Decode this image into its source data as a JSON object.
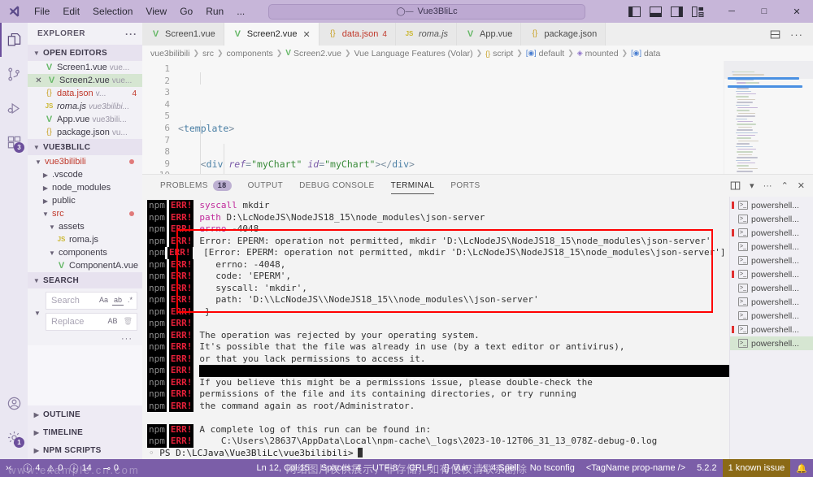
{
  "titlebar": {
    "menu": [
      "File",
      "Edit",
      "Selection",
      "View",
      "Go",
      "Run",
      "..."
    ],
    "search_value": "Vue3BliLc",
    "search_icon": "search-icon",
    "nav_back": "←",
    "nav_forward": "→",
    "minimize": "─",
    "maximize": "□",
    "close": "✕"
  },
  "activitybar": {
    "items": [
      {
        "name": "explorer",
        "icon": "files-icon",
        "badge": ""
      },
      {
        "name": "source-control",
        "icon": "source-control-icon",
        "badge": ""
      },
      {
        "name": "run-debug",
        "icon": "run-debug-icon",
        "badge": ""
      },
      {
        "name": "extensions",
        "icon": "extensions-icon",
        "badge": "3"
      }
    ],
    "account_badge": "",
    "settings_badge": "1"
  },
  "sidebar": {
    "title": "EXPLORER",
    "more": "···",
    "open_editors": {
      "label": "OPEN EDITORS",
      "items": [
        {
          "icon": "vue",
          "name": "Screen1.vue",
          "path": "vue...",
          "badge": "",
          "selected": false,
          "close": false
        },
        {
          "icon": "vue",
          "name": "Screen2.vue",
          "path": "vue...",
          "badge": "",
          "selected": true,
          "close": true
        },
        {
          "icon": "json",
          "name": "data.json",
          "path": "v...",
          "badge": "4",
          "selected": false,
          "close": false
        },
        {
          "icon": "js",
          "name": "roma.js",
          "path": "vue3bilibi...",
          "badge": "",
          "selected": false,
          "close": false
        },
        {
          "icon": "vue",
          "name": "App.vue",
          "path": "vue3bili...",
          "badge": "",
          "selected": false,
          "close": false
        },
        {
          "icon": "json",
          "name": "package.json",
          "path": "vu...",
          "badge": "",
          "selected": false,
          "close": false
        }
      ]
    },
    "project": {
      "label": "VUE3BLILC",
      "items": [
        {
          "name": "vue3bilibili",
          "depth": 1,
          "expanded": true,
          "red": true,
          "dot": true,
          "icon": ""
        },
        {
          "name": ".vscode",
          "depth": 2,
          "expanded": false,
          "red": false,
          "dot": false,
          "icon": ""
        },
        {
          "name": "node_modules",
          "depth": 2,
          "expanded": false,
          "red": false,
          "dot": false,
          "icon": ""
        },
        {
          "name": "public",
          "depth": 2,
          "expanded": false,
          "red": false,
          "dot": false,
          "icon": ""
        },
        {
          "name": "src",
          "depth": 2,
          "expanded": true,
          "red": true,
          "dot": true,
          "icon": ""
        },
        {
          "name": "assets",
          "depth": 3,
          "expanded": true,
          "red": false,
          "dot": false,
          "icon": ""
        },
        {
          "name": "roma.js",
          "depth": 4,
          "expanded": null,
          "red": false,
          "dot": false,
          "icon": "js"
        },
        {
          "name": "components",
          "depth": 3,
          "expanded": true,
          "red": false,
          "dot": false,
          "icon": ""
        },
        {
          "name": "ComponentA.vue",
          "depth": 4,
          "expanded": null,
          "red": false,
          "dot": false,
          "icon": "vue"
        }
      ]
    },
    "search": {
      "label": "SEARCH",
      "search_placeholder": "Search",
      "search_value": "",
      "replace_placeholder": "Replace",
      "replace_value": "",
      "match_case": "Aa",
      "whole_word": "ab",
      "regex": ".*",
      "preserve_case": "AB",
      "replace_all_icon": "replace-all-icon",
      "more": "···"
    },
    "bottom_sections": [
      "OUTLINE",
      "TIMELINE",
      "NPM SCRIPTS"
    ]
  },
  "editor": {
    "tabs": [
      {
        "icon": "vue",
        "label": "Screen1.vue",
        "active": false,
        "close": false,
        "badge": "",
        "italic": false
      },
      {
        "icon": "vue",
        "label": "Screen2.vue",
        "active": true,
        "close": true,
        "badge": "",
        "italic": false
      },
      {
        "icon": "json",
        "label": "data.json",
        "active": false,
        "close": false,
        "badge": "4",
        "italic": false,
        "red": true
      },
      {
        "icon": "js",
        "label": "roma.js",
        "active": false,
        "close": false,
        "badge": "",
        "italic": true
      },
      {
        "icon": "vue",
        "label": "App.vue",
        "active": false,
        "close": false,
        "badge": "",
        "italic": false
      },
      {
        "icon": "json",
        "label": "package.json",
        "active": false,
        "close": false,
        "badge": "",
        "italic": false
      }
    ],
    "tabs_right": {
      "split_icon": "split-editor-icon",
      "more": "···"
    },
    "breadcrumb": [
      {
        "label": "vue3bilibili",
        "icon": ""
      },
      {
        "label": "src",
        "icon": ""
      },
      {
        "label": "components",
        "icon": ""
      },
      {
        "label": "Screen2.vue",
        "icon": "vue"
      },
      {
        "label": "Vue Language Features (Volar)",
        "icon": ""
      },
      {
        "label": "script",
        "icon": "json"
      },
      {
        "label": "default",
        "icon": "blue"
      },
      {
        "label": "mounted",
        "icon": "purple"
      },
      {
        "label": "data",
        "icon": "blue"
      }
    ],
    "line_numbers": [
      "1",
      "2",
      "3",
      "4",
      "5",
      "6",
      "7",
      "8",
      "9",
      "10"
    ]
  },
  "panel": {
    "tabs": [
      {
        "label": "PROBLEMS",
        "count": "18",
        "active": false
      },
      {
        "label": "OUTPUT",
        "count": "",
        "active": false
      },
      {
        "label": "DEBUG CONSOLE",
        "count": "",
        "active": false
      },
      {
        "label": "TERMINAL",
        "count": "",
        "active": true
      },
      {
        "label": "PORTS",
        "count": "",
        "active": false
      }
    ],
    "controls": {
      "split": "split-terminal-icon",
      "launch_profile": "chevron-down-icon",
      "views_and_more": "···",
      "maximize": "⌃",
      "close": "✕"
    },
    "terminal": {
      "prefix": "npm",
      "err_prefix": "ERR!",
      "lines": [
        {
          "pfx": true,
          "text": "syscall mkdir",
          "mag": "syscall"
        },
        {
          "pfx": true,
          "text": "path D:\\LcNodeJS\\NodeJS18_15\\node_modules\\json-server",
          "mag": "path"
        },
        {
          "pfx": true,
          "text": "errno -4048",
          "mag": "errno"
        },
        {
          "pfx": true,
          "text": "Error: EPERM: operation not permitted, mkdir 'D:\\LcNodeJS\\NodeJS18_15\\node_modules\\json-server'"
        },
        {
          "pfx": true,
          "text": " [Error: EPERM: operation not permitted, mkdir 'D:\\LcNodeJS\\NodeJS18_15\\node_modules\\json-server'] {"
        },
        {
          "pfx": true,
          "text": "   errno: -4048,"
        },
        {
          "pfx": true,
          "text": "   code: 'EPERM',"
        },
        {
          "pfx": true,
          "text": "   syscall: 'mkdir',"
        },
        {
          "pfx": true,
          "text": "   path: 'D:\\\\LcNodeJS\\\\NodeJS18_15\\\\node_modules\\\\json-server'"
        },
        {
          "pfx": true,
          "text": " }"
        },
        {
          "pfx": true,
          "text": ""
        },
        {
          "pfx": true,
          "text": "The operation was rejected by your operating system."
        },
        {
          "pfx": true,
          "text": "It's possible that the file was already in use (by a text editor or antivirus),"
        },
        {
          "pfx": true,
          "text": "or that you lack permissions to access it."
        },
        {
          "pfx": true,
          "text": "",
          "blackbar": true
        },
        {
          "pfx": true,
          "text": "If you believe this might be a permissions issue, please double-check the"
        },
        {
          "pfx": true,
          "text": "permissions of the file and its containing directories, or try running"
        },
        {
          "pfx": true,
          "text": "the command again as root/Administrator."
        },
        {
          "pfx": false,
          "text": ""
        },
        {
          "pfx": true,
          "text": "A complete log of this run can be found in:"
        },
        {
          "pfx": true,
          "text": "    C:\\Users\\28637\\AppData\\Local\\npm-cache\\_logs\\2023-10-12T06_31_13_078Z-debug-0.log"
        }
      ],
      "prompt": "PS D:\\LCJava\\Vue3BliLc\\vue3bilibili>",
      "highlight_box_color": "#ff0000"
    },
    "terminal_list": {
      "label": "powershell...",
      "count": 11,
      "selected_index": 10,
      "marked_indices": [
        0,
        2,
        5,
        10
      ]
    }
  },
  "statusbar": {
    "left": [
      {
        "name": "remote",
        "label": "",
        "icon": "remote-icon"
      },
      {
        "name": "errors",
        "label": "4",
        "icon": "error-icon"
      },
      {
        "name": "warnings",
        "label": "0",
        "icon": "warning-icon"
      },
      {
        "name": "infos",
        "label": "14",
        "icon": "info-icon"
      },
      {
        "name": "ports",
        "label": "0",
        "icon": "ports-icon"
      }
    ],
    "right": [
      {
        "name": "cursor-position",
        "label": "Ln 12, Col 15"
      },
      {
        "name": "indentation",
        "label": "Spaces: 4"
      },
      {
        "name": "encoding",
        "label": "UTF-8"
      },
      {
        "name": "eol",
        "label": "CRLF"
      },
      {
        "name": "language-mode",
        "label": "Vue",
        "icon": "vue-lang-icon"
      },
      {
        "name": "spell-checker",
        "label": "4 Spell",
        "icon": "warning-icon"
      },
      {
        "name": "tsconfig",
        "label": "No tsconfig"
      },
      {
        "name": "tag-name",
        "label": "<TagName prop-name />"
      },
      {
        "name": "version",
        "label": "5.2.2"
      },
      {
        "name": "known-issues",
        "label": "1 known issue"
      },
      {
        "name": "notifications",
        "label": "",
        "icon": "bell-icon"
      }
    ]
  },
  "watermark": {
    "text": "网络图片仅供展示，非存储，如有侵权请联系删除",
    "text2": "www.example.cn.com"
  }
}
